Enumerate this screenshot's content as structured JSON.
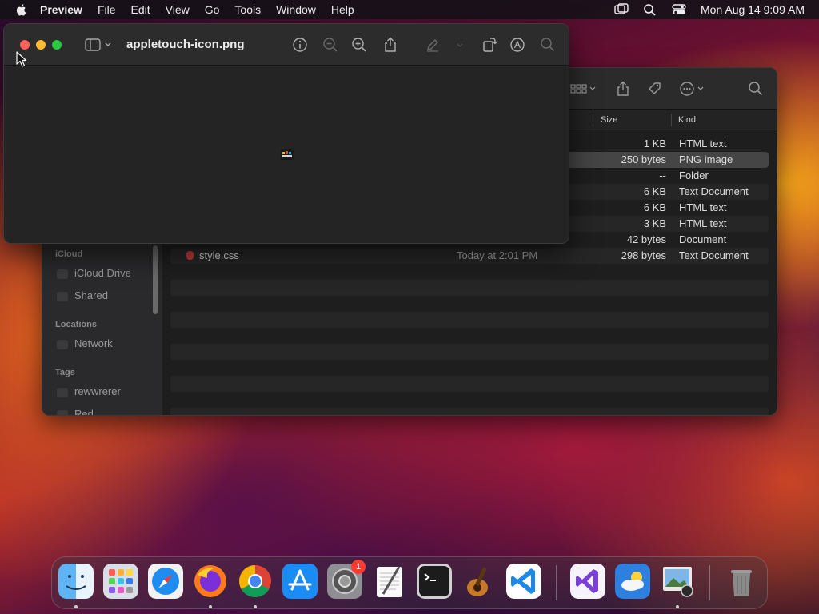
{
  "menubar": {
    "app_name": "Preview",
    "items": [
      "File",
      "Edit",
      "View",
      "Go",
      "Tools",
      "Window",
      "Help"
    ],
    "datetime": "Mon Aug 14  9:09 AM"
  },
  "preview": {
    "title": "appletouch-icon.png"
  },
  "finder": {
    "columns": {
      "size": "Size",
      "kind": "Kind"
    },
    "sidebar": {
      "icloud_header": "iCloud",
      "icloud_drive": "iCloud Drive",
      "shared": "Shared",
      "locations_header": "Locations",
      "network": "Network",
      "tags_header": "Tags",
      "tag1": "rewwrerer",
      "tag2": "Red"
    },
    "rows": [
      {
        "name": "",
        "date": "",
        "size": "1 KB",
        "kind": "HTML text"
      },
      {
        "name": "",
        "date": "",
        "size": "250 bytes",
        "kind": "PNG image"
      },
      {
        "name": "",
        "date": "",
        "size": "--",
        "kind": "Folder"
      },
      {
        "name": "",
        "date": "",
        "size": "6 KB",
        "kind": "Text Document"
      },
      {
        "name": "",
        "date": "",
        "size": "6 KB",
        "kind": "HTML text"
      },
      {
        "name": "",
        "date": "",
        "size": "3 KB",
        "kind": "HTML text"
      },
      {
        "name": "",
        "date": "",
        "size": "42 bytes",
        "kind": "Document"
      },
      {
        "name": "style.css",
        "date": "Today at 2:01 PM",
        "size": "298 bytes",
        "kind": "Text Document"
      }
    ]
  },
  "dock": {
    "apps": [
      "Finder",
      "Launchpad",
      "Safari",
      "Firefox",
      "Chrome",
      "App Store",
      "System Settings",
      "TextEdit",
      "Terminal",
      "Instruments",
      "Visual Studio Code",
      "Visual Studio",
      "Weather",
      "Preview",
      "Trash"
    ],
    "settings_badge": "1"
  },
  "colors": {
    "close": "#ff5f57",
    "minimize": "#febc2e",
    "maximize": "#28c840",
    "badge": "#ff3b30"
  }
}
